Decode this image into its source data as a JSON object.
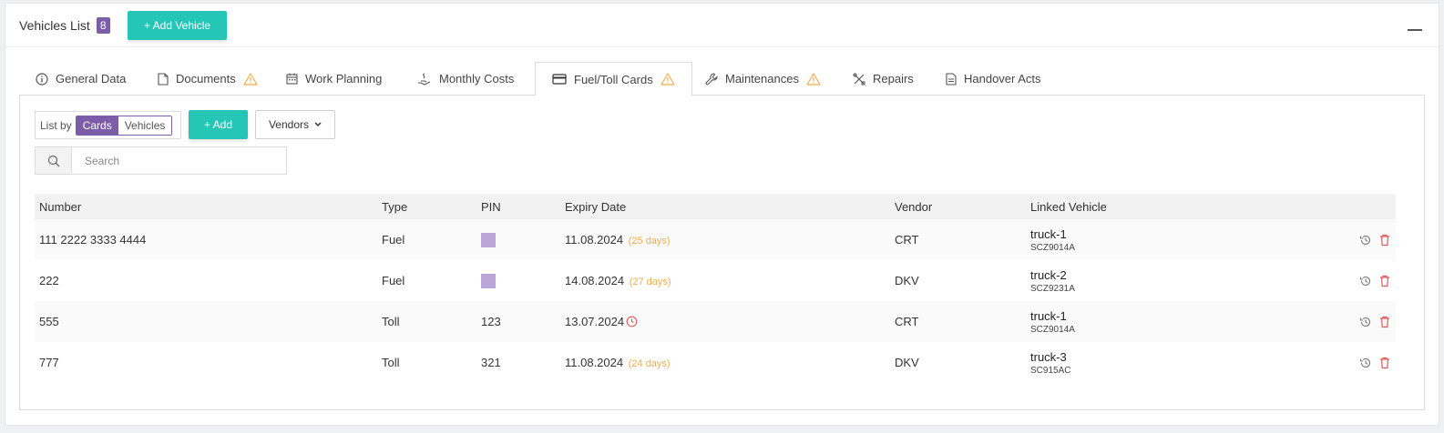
{
  "header": {
    "title": "Vehicles List",
    "count": "8",
    "add_vehicle_label": "+ Add Vehicle"
  },
  "tabs": [
    {
      "label": "General Data",
      "icon": "info-icon",
      "warning": false
    },
    {
      "label": "Documents",
      "icon": "document-icon",
      "warning": true
    },
    {
      "label": "Work Planning",
      "icon": "calendar-icon",
      "warning": false
    },
    {
      "label": "Monthly Costs",
      "icon": "hand-coins-icon",
      "warning": false
    },
    {
      "label": "Fuel/Toll Cards",
      "icon": "credit-card-icon",
      "warning": true,
      "active": true
    },
    {
      "label": "Maintenances",
      "icon": "wrench-icon",
      "warning": true
    },
    {
      "label": "Repairs",
      "icon": "tools-icon",
      "warning": false
    },
    {
      "label": "Handover Acts",
      "icon": "file-text-icon",
      "warning": false
    }
  ],
  "toolbar": {
    "list_by_label": "List by",
    "toggle_cards": "Cards",
    "toggle_vehicles": "Vehicles",
    "add_label": "+ Add",
    "vendors_label": "Vendors"
  },
  "search": {
    "placeholder": "Search"
  },
  "table": {
    "columns": [
      "Number",
      "Type",
      "PIN",
      "Expiry Date",
      "Vendor",
      "Linked Vehicle"
    ],
    "rows": [
      {
        "number": "111 2222 3333 4444",
        "type": "Fuel",
        "pin": "",
        "pin_masked": true,
        "expiry": "11.08.2024",
        "days": "(25 days)",
        "expired": false,
        "vendor": "CRT",
        "vehicle": "truck-1",
        "plate": "SCZ9014A"
      },
      {
        "number": "222",
        "type": "Fuel",
        "pin": "",
        "pin_masked": true,
        "expiry": "14.08.2024",
        "days": "(27 days)",
        "expired": false,
        "vendor": "DKV",
        "vehicle": "truck-2",
        "plate": "SCZ9231A"
      },
      {
        "number": "555",
        "type": "Toll",
        "pin": "123",
        "pin_masked": false,
        "expiry": "13.07.2024",
        "days": "",
        "expired": true,
        "vendor": "CRT",
        "vehicle": "truck-1",
        "plate": "SCZ9014A"
      },
      {
        "number": "777",
        "type": "Toll",
        "pin": "321",
        "pin_masked": false,
        "expiry": "11.08.2024",
        "days": "(24 days)",
        "expired": false,
        "vendor": "DKV",
        "vehicle": "truck-3",
        "plate": "SC915AC"
      }
    ]
  },
  "colors": {
    "accent_teal": "#26c6b6",
    "accent_purple": "#7b5ea7",
    "warning_orange": "#f0ad4e",
    "danger_red": "#e05a5a"
  }
}
